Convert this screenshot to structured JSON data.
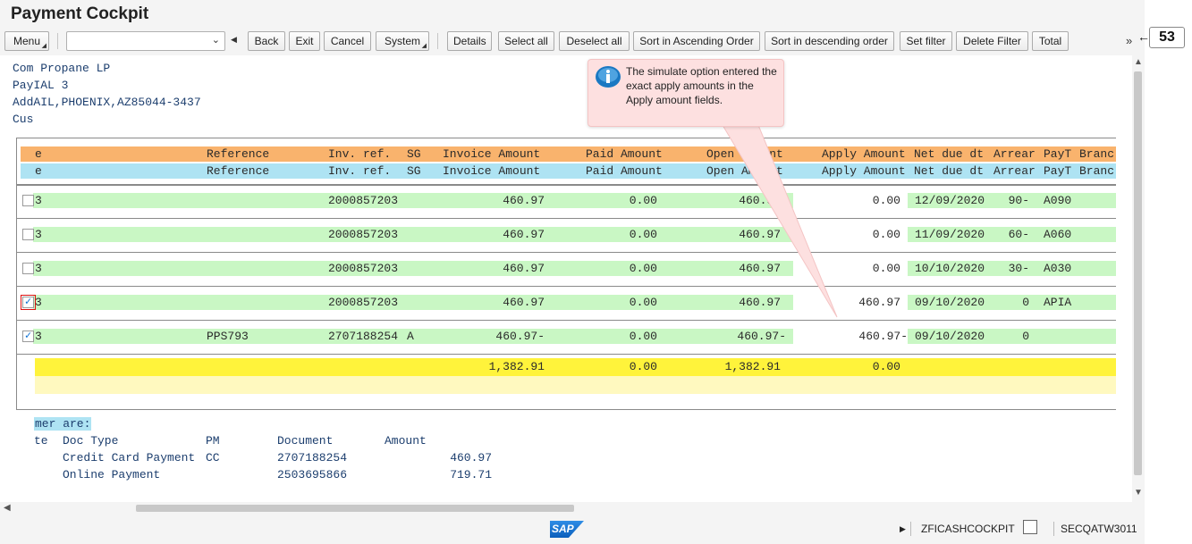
{
  "app": {
    "title": "Payment Cockpit"
  },
  "toolbar": {
    "menu": "Menu",
    "command_value": "",
    "back": "Back",
    "exit": "Exit",
    "cancel": "Cancel",
    "system": "System",
    "details": "Details",
    "select_all": "Select all",
    "deselect_all": "Deselect all",
    "sort_asc": "Sort in Ascending Order",
    "sort_desc": "Sort in descending order",
    "set_filter": "Set filter",
    "delete_filter": "Delete Filter",
    "total": "Total",
    "more": "»"
  },
  "address": [
    "Com Propane LP",
    "PayIAL 3",
    "AddAIL,PHOENIX,AZ85044-3437",
    "Cus"
  ],
  "columns": {
    "c0": "e",
    "reference": "Reference",
    "invref": "Inv. ref.",
    "sg": "SG",
    "invoice": "Invoice Amount",
    "paid": "Paid Amount",
    "open": "Open Amount",
    "apply": "Apply Amount",
    "netdue": "Net due dt",
    "arrear": "Arrear",
    "payt": "PayT",
    "branch": "Branc"
  },
  "rows": [
    {
      "checked": "",
      "c0": "3",
      "reference": "",
      "invref": "2000857203",
      "sg": "",
      "invoice": "460.97",
      "paid": "0.00",
      "open": "460.97",
      "apply": "0.00",
      "netdue": "12/09/2020",
      "arrear": "90-",
      "payt": "A090"
    },
    {
      "checked": "",
      "c0": "3",
      "reference": "",
      "invref": "2000857203",
      "sg": "",
      "invoice": "460.97",
      "paid": "0.00",
      "open": "460.97",
      "apply": "0.00",
      "netdue": "11/09/2020",
      "arrear": "60-",
      "payt": "A060"
    },
    {
      "checked": "",
      "c0": "3",
      "reference": "",
      "invref": "2000857203",
      "sg": "",
      "invoice": "460.97",
      "paid": "0.00",
      "open": "460.97",
      "apply": "0.00",
      "netdue": "10/10/2020",
      "arrear": "30-",
      "payt": "A030"
    },
    {
      "checked": "✓",
      "c0": "3",
      "reference": "",
      "invref": "2000857203",
      "sg": "",
      "invoice": "460.97",
      "paid": "0.00",
      "open": "460.97",
      "apply": "460.97",
      "netdue": "09/10/2020",
      "arrear": "0",
      "payt": "APIA"
    },
    {
      "checked": "✓",
      "c0": "3",
      "reference": "PPS793",
      "invref": "2707188254",
      "sg": "A",
      "invoice": "460.97-",
      "paid": "0.00",
      "open": "460.97-",
      "apply": "460.97-",
      "netdue": "09/10/2020",
      "arrear": "0",
      "payt": ""
    }
  ],
  "totals": {
    "invoice": "1,382.91",
    "paid": "0.00",
    "open": "1,382.91",
    "apply": "0.00"
  },
  "summary": {
    "header": "mer are:",
    "col_te": "te",
    "col_doctype": "Doc Type",
    "col_pm": "PM",
    "col_document": "Document",
    "col_amount": "Amount",
    "lines": [
      {
        "doctype": "Credit Card Payment",
        "pm": "CC",
        "document": "2707188254",
        "amount": "460.97"
      },
      {
        "doctype": "Online Payment",
        "pm": "",
        "document": "2503695866",
        "amount": "719.71"
      }
    ]
  },
  "tooltip": {
    "text": "The simulate option entered the exact apply amounts in the Apply amount fields."
  },
  "status": {
    "logo": "SAP",
    "transaction": "ZFICASHCOCKPIT",
    "system": "SECQATW3011"
  },
  "annotation": {
    "step": "53"
  },
  "colors": {
    "header_orange": "#f9b36d",
    "header_blue": "#aee3f3",
    "row_green": "#c9f7c4",
    "total_yellow": "#fff33b",
    "tooltip_pink": "#fde0e0"
  }
}
